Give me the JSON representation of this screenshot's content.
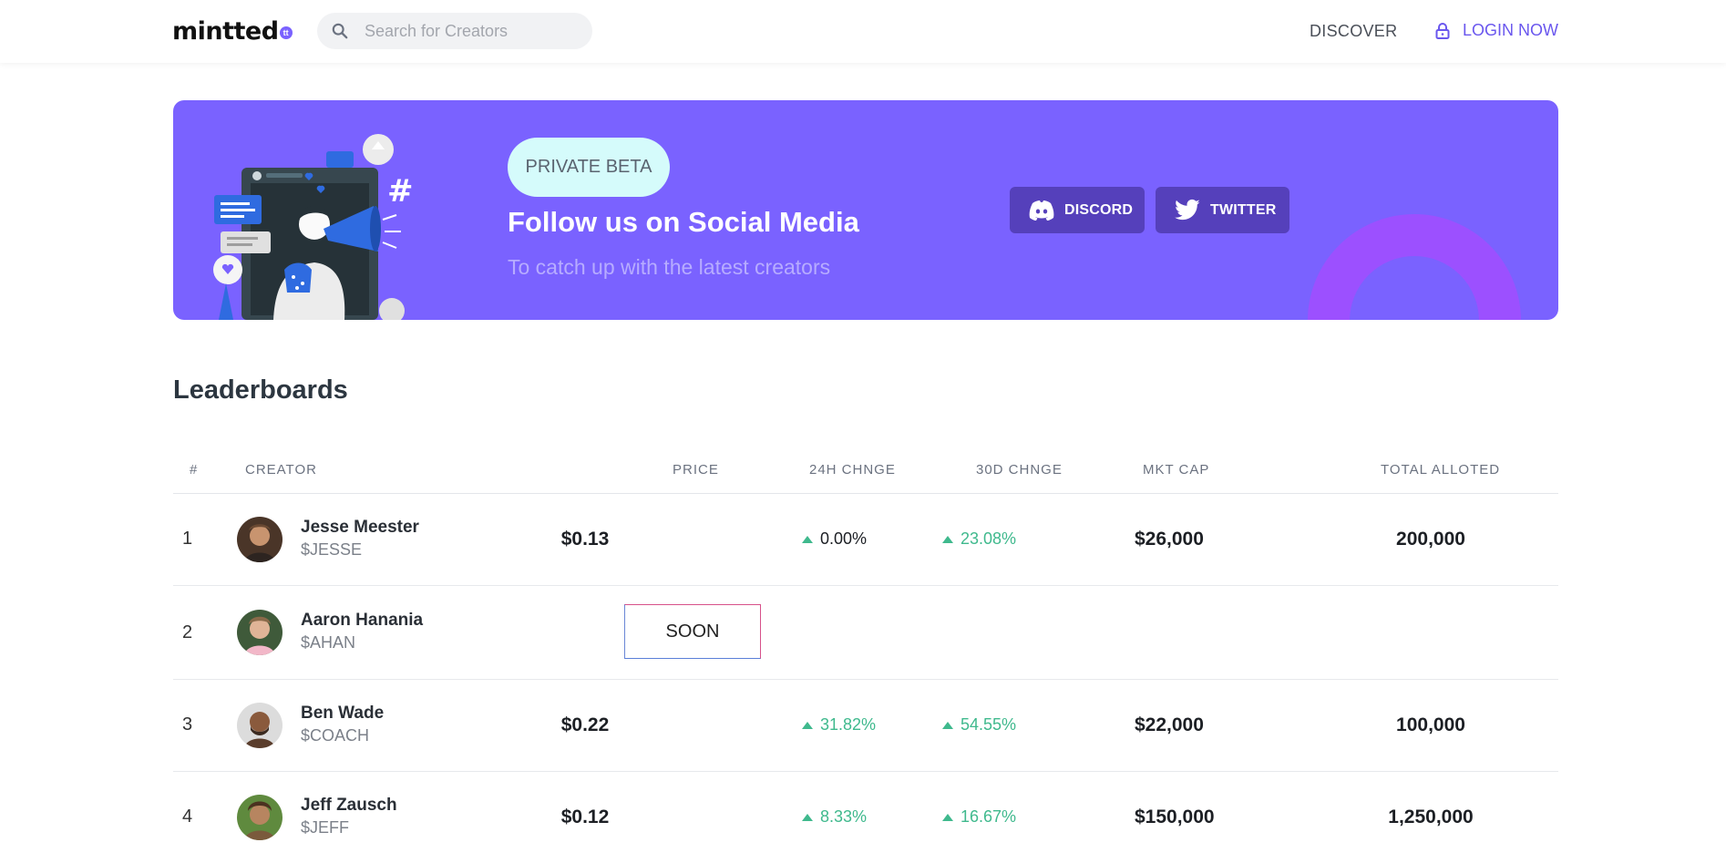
{
  "header": {
    "logo_text": "mintted",
    "logo_badge": "tt",
    "search_placeholder": "Search for Creators",
    "nav_discover": "DISCOVER",
    "nav_login": "LOGIN NOW",
    "accent_color": "#6a57ee"
  },
  "banner": {
    "badge": "PRIVATE BETA",
    "title": "Follow us on Social Media",
    "subtitle": "To catch up with the latest creators",
    "discord_label": "DISCORD",
    "twitter_label": "TWITTER",
    "illustration_icon": "megaphone-woman-illustration",
    "background_color": "#7a62ff"
  },
  "leaderboard": {
    "title": "Leaderboards",
    "columns": {
      "rank": "#",
      "creator": "CREATOR",
      "price": "PRICE",
      "change_24h": "24H CHNGE",
      "change_30d": "30D CHNGE",
      "market_cap": "MKT CAP",
      "total_alloted": "TOTAL ALLOTED"
    },
    "rows": [
      {
        "rank": "1",
        "name": "Jesse Meester",
        "ticker": "$JESSE",
        "price": "$0.13",
        "change_24h": "0.00%",
        "change_30d": "23.08%",
        "market_cap": "$26,000",
        "total_alloted": "200,000"
      },
      {
        "rank": "2",
        "name": "Aaron Hanania",
        "ticker": "$AHAN",
        "soon_label": "SOON"
      },
      {
        "rank": "3",
        "name": "Ben Wade",
        "ticker": "$COACH",
        "price": "$0.22",
        "change_24h": "31.82%",
        "change_30d": "54.55%",
        "market_cap": "$22,000",
        "total_alloted": "100,000"
      },
      {
        "rank": "4",
        "name": "Jeff Zausch",
        "ticker": "$JEFF",
        "price": "$0.12",
        "change_24h": "8.33%",
        "change_30d": "16.67%",
        "market_cap": "$150,000",
        "total_alloted": "1,250,000"
      }
    ],
    "positive_color": "#3fb98d"
  }
}
